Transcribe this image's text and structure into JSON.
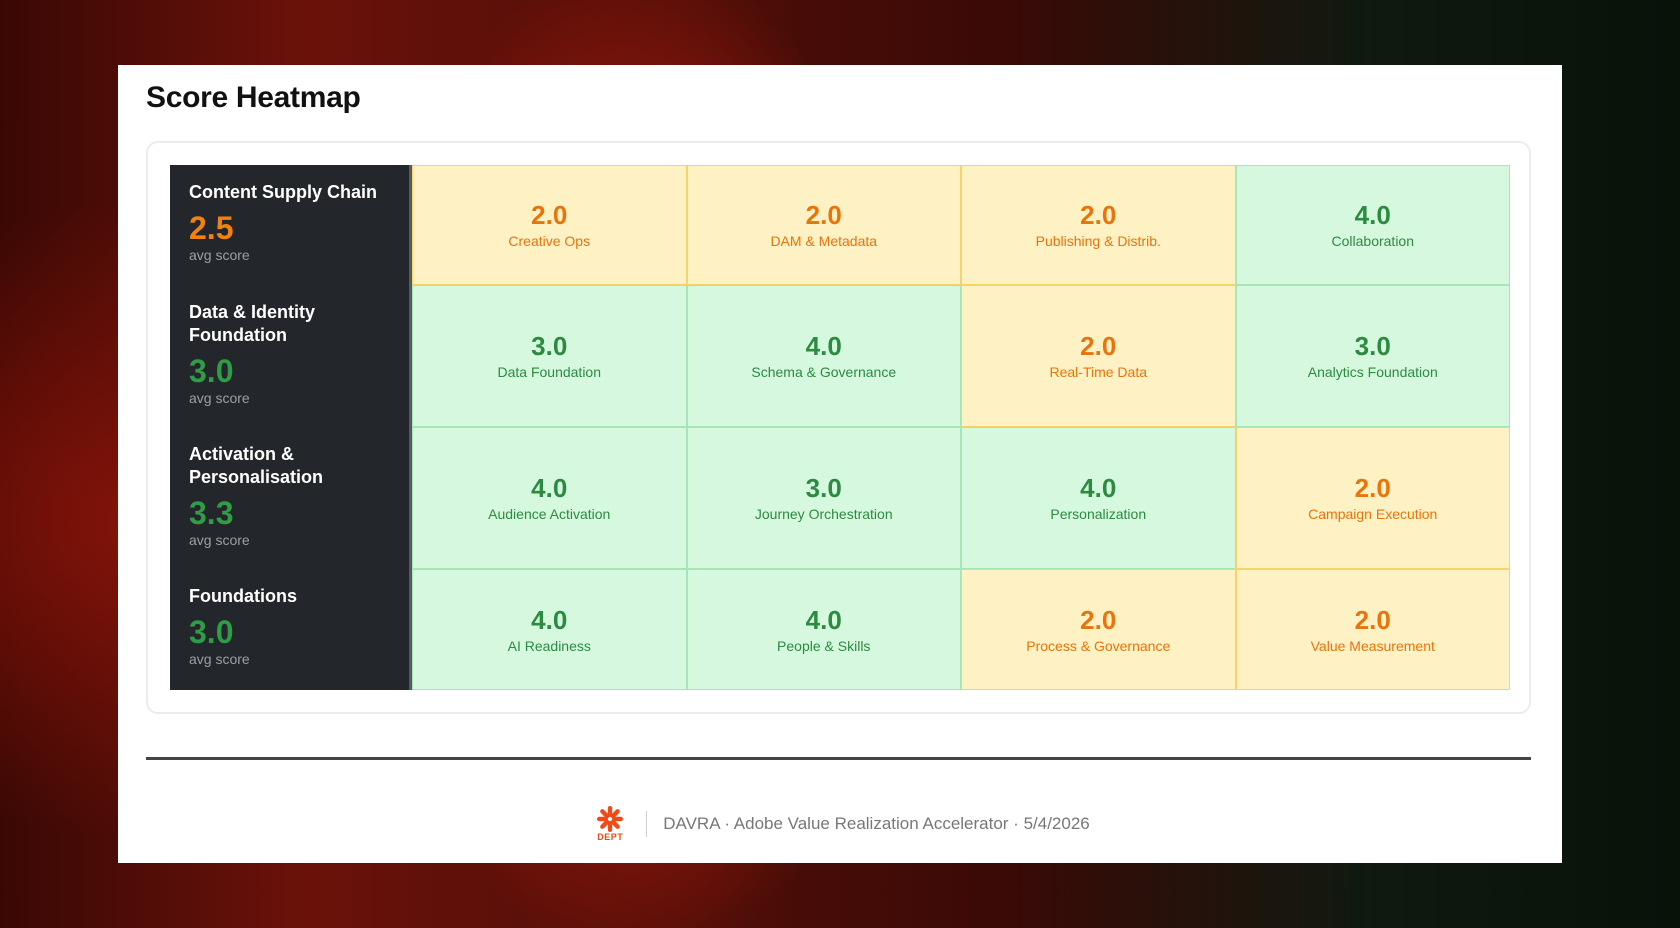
{
  "page": {
    "title": "Score Heatmap"
  },
  "pillars": [
    {
      "name": "Content Supply Chain",
      "score": "2.5",
      "level": "amber",
      "sub": "avg score",
      "cells": [
        {
          "score": "2.0",
          "label": "Creative Ops",
          "level": "amber"
        },
        {
          "score": "2.0",
          "label": "DAM & Metadata",
          "level": "amber"
        },
        {
          "score": "2.0",
          "label": "Publishing & Distrib.",
          "level": "amber"
        },
        {
          "score": "4.0",
          "label": "Collaboration",
          "level": "green"
        }
      ]
    },
    {
      "name": "Data & Identity Foundation",
      "score": "3.0",
      "level": "green",
      "sub": "avg score",
      "cells": [
        {
          "score": "3.0",
          "label": "Data Foundation",
          "level": "green"
        },
        {
          "score": "4.0",
          "label": "Schema & Governance",
          "level": "green"
        },
        {
          "score": "2.0",
          "label": "Real-Time Data",
          "level": "amber"
        },
        {
          "score": "3.0",
          "label": "Analytics Foundation",
          "level": "green"
        }
      ]
    },
    {
      "name": "Activation & Personalisation",
      "score": "3.3",
      "level": "green",
      "sub": "avg score",
      "cells": [
        {
          "score": "4.0",
          "label": "Audience Activation",
          "level": "green"
        },
        {
          "score": "3.0",
          "label": "Journey Orchestration",
          "level": "green"
        },
        {
          "score": "4.0",
          "label": "Personalization",
          "level": "green"
        },
        {
          "score": "2.0",
          "label": "Campaign Execution",
          "level": "amber"
        }
      ]
    },
    {
      "name": "Foundations",
      "score": "3.0",
      "level": "green",
      "sub": "avg score",
      "cells": [
        {
          "score": "4.0",
          "label": "AI Readiness",
          "level": "green"
        },
        {
          "score": "4.0",
          "label": "People & Skills",
          "level": "green"
        },
        {
          "score": "2.0",
          "label": "Process & Governance",
          "level": "amber"
        },
        {
          "score": "2.0",
          "label": "Value Measurement",
          "level": "amber"
        }
      ]
    }
  ],
  "footer": {
    "logo_text": "DEPT",
    "logo_icon": "dept-asterisk-icon",
    "text": "DAVRA · Adobe Value Realization Accelerator · 5/4/2026"
  },
  "colors": {
    "amber": "#f0820f",
    "green": "#2f9c46",
    "brand": "#f04a16",
    "pillar_bg": "#23262b"
  }
}
